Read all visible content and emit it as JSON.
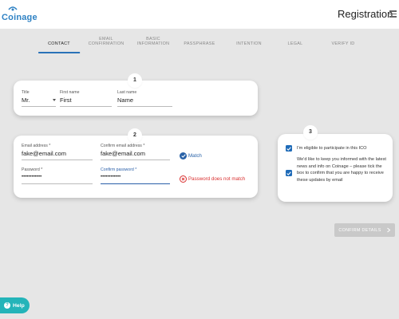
{
  "header": {
    "logo_text": "Coinage",
    "title": "Registration",
    "menu_icon": "hamburger-menu-icon"
  },
  "steps": [
    {
      "line1": "CONTACT",
      "line2": "",
      "active": true
    },
    {
      "line1": "EMAIL",
      "line2": "CONFIRMATION",
      "active": false
    },
    {
      "line1": "BASIC",
      "line2": "INFORMATION",
      "active": false
    },
    {
      "line1": "PASSPHRASE",
      "line2": "",
      "active": false
    },
    {
      "line1": "INTENTION",
      "line2": "",
      "active": false
    },
    {
      "line1": "LEGAL",
      "line2": "",
      "active": false
    },
    {
      "line1": "VERIFY ID",
      "line2": "",
      "active": false
    }
  ],
  "section1": {
    "number": "1",
    "title_field": {
      "label": "Title",
      "value": "Mr."
    },
    "first_name": {
      "label": "First name",
      "value": "First"
    },
    "last_name": {
      "label": "Last name",
      "value": "Name"
    }
  },
  "section2": {
    "number": "2",
    "email": {
      "label": "Email address *",
      "value": "fake@email.com"
    },
    "confirm_email": {
      "label": "Confirm email address *",
      "value": "fake@email.com"
    },
    "match_status": "Match",
    "password": {
      "label": "Password *",
      "value": "••••••••••••"
    },
    "confirm_password": {
      "label": "Confirm password *",
      "value": "••••••••••••"
    },
    "password_status": "Password does not match"
  },
  "section3": {
    "number": "3",
    "checks": [
      {
        "text": "I'm eligible to participate in this ICO",
        "checked": true
      },
      {
        "text": "We'd like to keep you informed with the latest news and info on Coinage – please tick the box to confirm that you are happy to receive these updates by email",
        "checked": true
      }
    ]
  },
  "actions": {
    "confirm_label": "CONFIRM DETAILS",
    "help_label": "Help"
  },
  "colors": {
    "accent": "#2a72b8",
    "error": "#d93030",
    "help": "#24b4b9",
    "disabled": "#c9c9c9"
  }
}
